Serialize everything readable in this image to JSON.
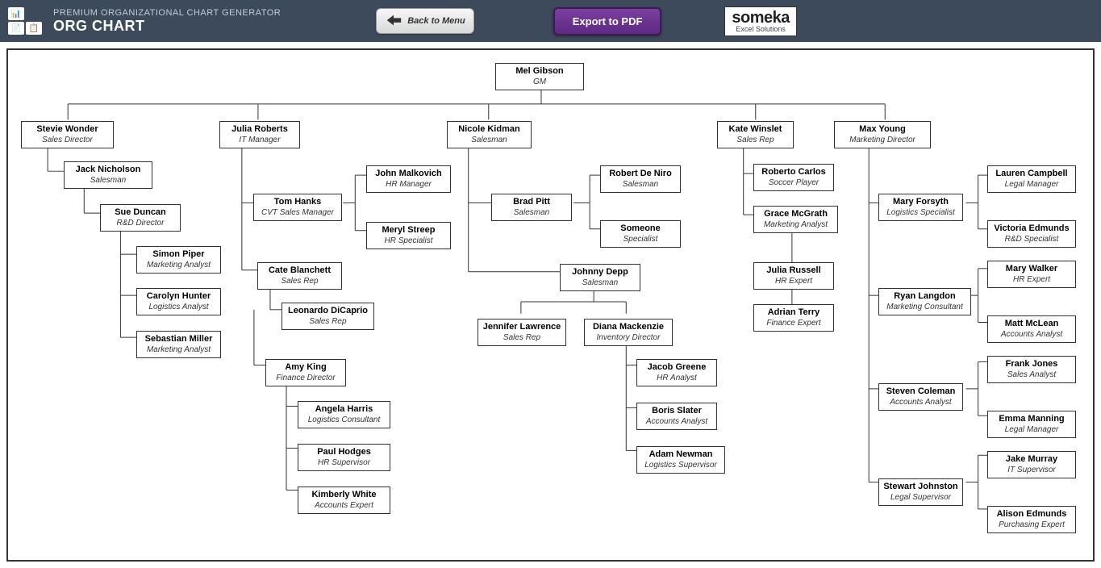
{
  "header": {
    "small_title": "PREMIUM ORGANIZATIONAL CHART GENERATOR",
    "big_title": "ORG CHART",
    "back_label": "Back to Menu",
    "export_label": "Export to PDF",
    "logo_main": "someka",
    "logo_sub": "Excel Solutions"
  },
  "nodes": {
    "n1": {
      "name": "Mel Gibson",
      "role": "GM"
    },
    "n2": {
      "name": "Stevie Wonder",
      "role": "Sales Director"
    },
    "n3": {
      "name": "Julia Roberts",
      "role": "IT Manager"
    },
    "n4": {
      "name": "Nicole Kidman",
      "role": "Salesman"
    },
    "n5": {
      "name": "Kate Winslet",
      "role": "Sales Rep"
    },
    "n6": {
      "name": "Max Young",
      "role": "Marketing Director"
    },
    "n7": {
      "name": "Jack Nicholson",
      "role": "Salesman"
    },
    "n8": {
      "name": "Sue Duncan",
      "role": "R&D Director"
    },
    "n9": {
      "name": "Simon Piper",
      "role": "Marketing Analyst"
    },
    "n10": {
      "name": "Carolyn Hunter",
      "role": "Logistics Analyst"
    },
    "n11": {
      "name": "Sebastian Miller",
      "role": "Marketing Analyst"
    },
    "n12": {
      "name": "Tom Hanks",
      "role": "CVT Sales Manager"
    },
    "n13": {
      "name": "John Malkovich",
      "role": "HR Manager"
    },
    "n14": {
      "name": "Meryl Streep",
      "role": "HR Specialist"
    },
    "n15": {
      "name": "Cate Blanchett",
      "role": "Sales Rep"
    },
    "n16": {
      "name": "Leonardo DiCaprio",
      "role": "Sales Rep"
    },
    "n17": {
      "name": "Amy King",
      "role": "Finance Director"
    },
    "n18": {
      "name": "Angela Harris",
      "role": "Logistics Consultant"
    },
    "n19": {
      "name": "Paul Hodges",
      "role": "HR Supervisor"
    },
    "n20": {
      "name": "Kimberly White",
      "role": "Accounts Expert"
    },
    "n21": {
      "name": "Brad Pitt",
      "role": "Salesman"
    },
    "n22": {
      "name": "Robert De Niro",
      "role": "Salesman"
    },
    "n23": {
      "name": "Someone",
      "role": "Specialist"
    },
    "n24": {
      "name": "Johnny Depp",
      "role": "Salesman"
    },
    "n25": {
      "name": "Jennifer Lawrence",
      "role": "Sales Rep"
    },
    "n26": {
      "name": "Diana Mackenzie",
      "role": "Inventory Director"
    },
    "n27": {
      "name": "Jacob Greene",
      "role": "HR Analyst"
    },
    "n28": {
      "name": "Boris Slater",
      "role": "Accounts Analyst"
    },
    "n29": {
      "name": "Adam Newman",
      "role": "Logistics Supervisor"
    },
    "n30": {
      "name": "Roberto Carlos",
      "role": "Soccer Player"
    },
    "n31": {
      "name": "Grace McGrath",
      "role": "Marketing Analyst"
    },
    "n32": {
      "name": "Julia Russell",
      "role": "HR Expert"
    },
    "n33": {
      "name": "Adrian Terry",
      "role": "Finance Expert"
    },
    "n34": {
      "name": "Mary Forsyth",
      "role": "Logistics Specialist"
    },
    "n35": {
      "name": "Lauren Campbell",
      "role": "Legal Manager"
    },
    "n36": {
      "name": "Victoria Edmunds",
      "role": "R&D Specialist"
    },
    "n37": {
      "name": "Ryan Langdon",
      "role": "Marketing Consultant"
    },
    "n38": {
      "name": "Mary Walker",
      "role": "HR Expert"
    },
    "n39": {
      "name": "Matt McLean",
      "role": "Accounts Analyst"
    },
    "n40": {
      "name": "Steven Coleman",
      "role": "Accounts Analyst"
    },
    "n41": {
      "name": "Frank Jones",
      "role": "Sales Analyst"
    },
    "n42": {
      "name": "Emma Manning",
      "role": "Legal Manager"
    },
    "n43": {
      "name": "Stewart Johnston",
      "role": "Legal Supervisor"
    },
    "n44": {
      "name": "Jake Murray",
      "role": "IT Supervisor"
    },
    "n45": {
      "name": "Alison Edmunds",
      "role": "Purchasing Expert"
    }
  },
  "chart_data": {
    "type": "org-tree",
    "root": "Mel Gibson (GM)",
    "edges": [
      [
        "Mel Gibson",
        "Stevie Wonder"
      ],
      [
        "Mel Gibson",
        "Julia Roberts"
      ],
      [
        "Mel Gibson",
        "Nicole Kidman"
      ],
      [
        "Mel Gibson",
        "Kate Winslet"
      ],
      [
        "Mel Gibson",
        "Max Young"
      ],
      [
        "Stevie Wonder",
        "Jack Nicholson"
      ],
      [
        "Jack Nicholson",
        "Sue Duncan"
      ],
      [
        "Sue Duncan",
        "Simon Piper"
      ],
      [
        "Sue Duncan",
        "Carolyn Hunter"
      ],
      [
        "Sue Duncan",
        "Sebastian Miller"
      ],
      [
        "Julia Roberts",
        "Tom Hanks"
      ],
      [
        "Tom Hanks",
        "John Malkovich"
      ],
      [
        "Tom Hanks",
        "Meryl Streep"
      ],
      [
        "Julia Roberts",
        "Cate Blanchett"
      ],
      [
        "Cate Blanchett",
        "Leonardo DiCaprio"
      ],
      [
        "Leonardo DiCaprio",
        "Amy King"
      ],
      [
        "Amy King",
        "Angela Harris"
      ],
      [
        "Amy King",
        "Paul Hodges"
      ],
      [
        "Amy King",
        "Kimberly White"
      ],
      [
        "Nicole Kidman",
        "Brad Pitt"
      ],
      [
        "Brad Pitt",
        "Robert De Niro"
      ],
      [
        "Brad Pitt",
        "Someone"
      ],
      [
        "Nicole Kidman",
        "Johnny Depp"
      ],
      [
        "Johnny Depp",
        "Jennifer Lawrence"
      ],
      [
        "Johnny Depp",
        "Diana Mackenzie"
      ],
      [
        "Diana Mackenzie",
        "Jacob Greene"
      ],
      [
        "Diana Mackenzie",
        "Boris Slater"
      ],
      [
        "Diana Mackenzie",
        "Adam Newman"
      ],
      [
        "Kate Winslet",
        "Roberto Carlos"
      ],
      [
        "Kate Winslet",
        "Grace McGrath"
      ],
      [
        "Grace McGrath",
        "Julia Russell"
      ],
      [
        "Grace McGrath",
        "Adrian Terry"
      ],
      [
        "Max Young",
        "Mary Forsyth"
      ],
      [
        "Mary Forsyth",
        "Lauren Campbell"
      ],
      [
        "Mary Forsyth",
        "Victoria Edmunds"
      ],
      [
        "Max Young",
        "Ryan Langdon"
      ],
      [
        "Ryan Langdon",
        "Mary Walker"
      ],
      [
        "Ryan Langdon",
        "Matt McLean"
      ],
      [
        "Max Young",
        "Steven Coleman"
      ],
      [
        "Steven Coleman",
        "Frank Jones"
      ],
      [
        "Steven Coleman",
        "Emma Manning"
      ],
      [
        "Max Young",
        "Stewart Johnston"
      ],
      [
        "Stewart Johnston",
        "Jake Murray"
      ],
      [
        "Stewart Johnston",
        "Alison Edmunds"
      ]
    ]
  }
}
